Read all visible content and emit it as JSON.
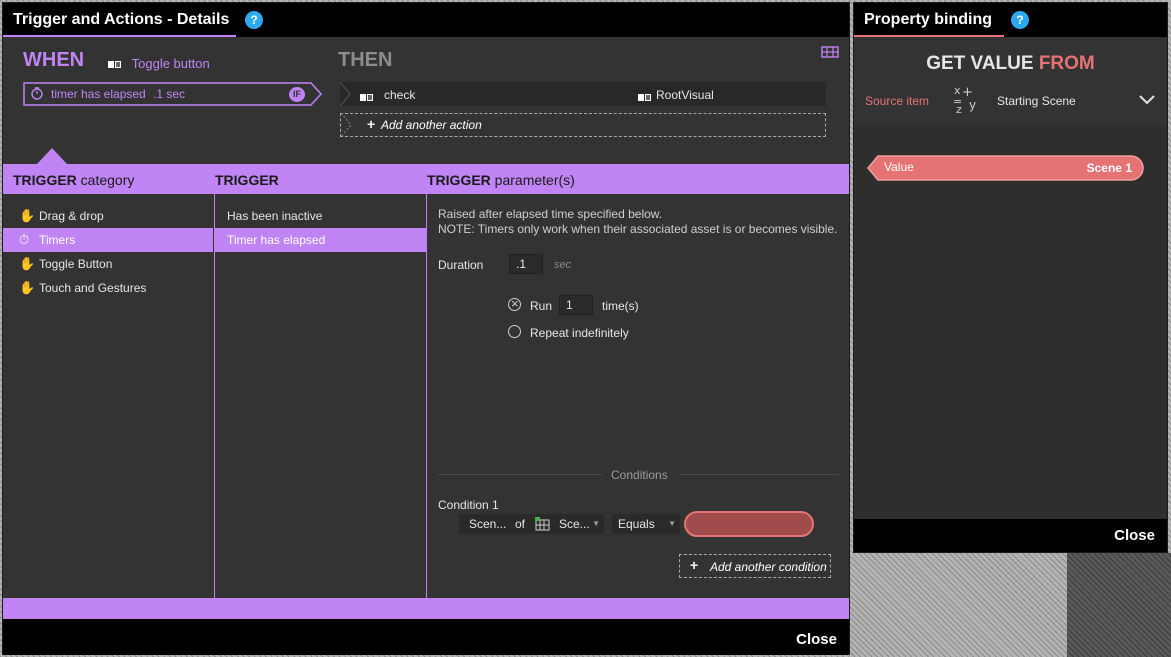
{
  "trigger_panel": {
    "title": "Trigger and Actions - Details",
    "help": "?",
    "when_label": "WHEN",
    "when_item": "Toggle button",
    "then_label": "THEN",
    "trigger_text": "timer has elapsed",
    "trigger_value": ".1 sec",
    "if_badge": "IF",
    "action_name": "check",
    "action_target": "RootVisual",
    "add_action": "Add another action",
    "category_header_bold": "TRIGGER",
    "category_header_rest": " category",
    "trigger_header": "TRIGGER",
    "params_header_bold": "TRIGGER",
    "params_header_rest": " parameter(s)",
    "categories": [
      {
        "label": "Drag & drop",
        "icon": "drag-hand-icon",
        "selected": false
      },
      {
        "label": "Timers",
        "icon": "timer-icon",
        "selected": true
      },
      {
        "label": "Toggle Button",
        "icon": "hand-icon",
        "selected": false
      },
      {
        "label": "Touch and Gestures",
        "icon": "hand-icon",
        "selected": false
      }
    ],
    "triggers": [
      {
        "label": "Has been inactive",
        "selected": false
      },
      {
        "label": "Timer has elapsed",
        "selected": true
      }
    ],
    "description_line1": "Raised after elapsed time specified below.",
    "description_line2": "NOTE: Timers only work when their associated asset is or becomes visible.",
    "duration_label": "Duration",
    "duration_value": ".1",
    "duration_unit": "sec",
    "run_label": "Run",
    "run_value": "1",
    "run_unit": "time(s)",
    "repeat_label": "Repeat indefinitely",
    "conditions_title": "Conditions",
    "condition1_label": "Condition 1",
    "condition_source": "Scen...",
    "condition_of": "of",
    "condition_prop": "Sce...",
    "condition_op": "Equals",
    "add_condition": "Add another condition",
    "close": "Close"
  },
  "binding_panel": {
    "title": "Property binding",
    "help": "?",
    "get_value": "GET VALUE",
    "from": "FROM",
    "source_label": "Source item",
    "source_value": "Starting Scene",
    "value_label": "Value",
    "value_text": "Scene 1",
    "close": "Close"
  },
  "colors": {
    "accent": "#c084f5",
    "binding_accent": "#e57373",
    "help_blue": "#2ea8f0"
  }
}
